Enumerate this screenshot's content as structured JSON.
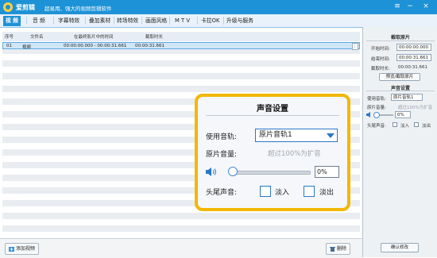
{
  "app": {
    "name": "爱剪辑",
    "subtitle": "超易用、强大的视频剪辑软件"
  },
  "menu": {
    "tabs": [
      {
        "label": "视 频",
        "active": true
      },
      {
        "label": "音 频"
      },
      {
        "label": "字幕特效"
      },
      {
        "label": "叠加素材"
      },
      {
        "label": "转场特效"
      },
      {
        "label": "画面风格"
      },
      {
        "label": "M T V"
      },
      {
        "label": "卡拉OK"
      },
      {
        "label": "升级与服务"
      }
    ]
  },
  "table": {
    "headers": [
      "序号",
      "文件名",
      "在最终影片中的时间",
      "截取时长"
    ],
    "rows": [
      {
        "index": "01",
        "file": "视频",
        "time": "00:00:00.000 - 00:00:31.661",
        "duration": "00:00:31.661",
        "menu": "⋮"
      }
    ]
  },
  "bottom_bar": {
    "add_video": "添加视频",
    "delete": "删除"
  },
  "right_panel": {
    "clip_section": "截取原片",
    "start_label": "开始时间:",
    "start_value": "00:00:00.000",
    "end_label": "结束时间:",
    "end_value": "00:00:31.661",
    "duration_label": "截取时长:",
    "duration_value": "00:00:31.661",
    "preview_button": "预览/截取原片",
    "audio_section": "声音设置",
    "track_label": "使用音轨:",
    "track_value": "原片音轨1",
    "volume_label": "原片音量:",
    "volume_hint": "超过100%为扩音",
    "volume_value": "0%",
    "fade_label": "头尾声音:",
    "fade_in": "淡入",
    "fade_out": "淡出",
    "confirm_button": "确认修改"
  },
  "callout": {
    "title": "声音设置",
    "track_label": "使用音轨:",
    "track_value": "原片音轨1",
    "volume_label": "原片音量:",
    "volume_hint": "超过100%为扩音",
    "volume_value": "0%",
    "volume_level": 0,
    "fade_label": "头尾声音:",
    "fade_in": "淡入",
    "fade_out": "淡出"
  },
  "colors": {
    "titlebar": "#1e92d6",
    "highlight": "#f2b705",
    "selected_row": "#cfe6f8"
  }
}
